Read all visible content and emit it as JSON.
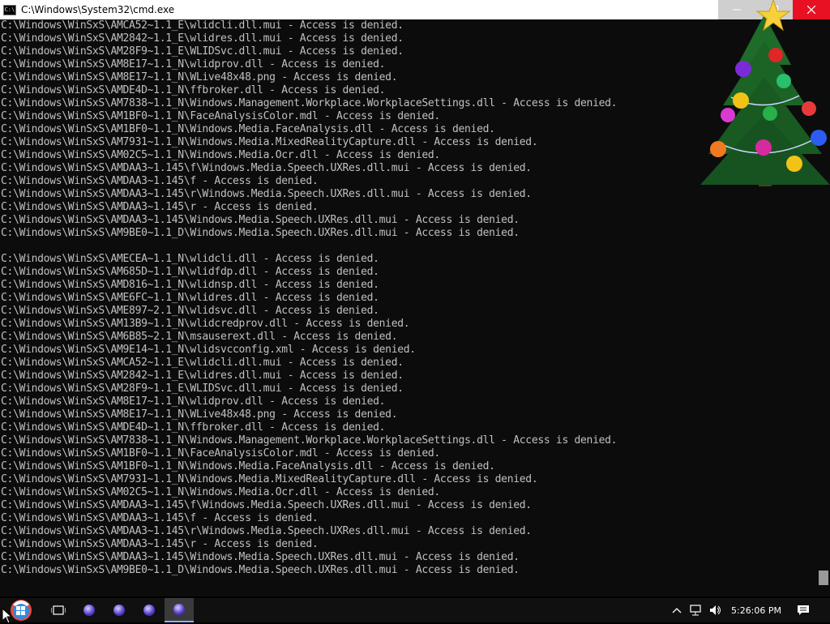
{
  "window": {
    "title": "C:\\Windows\\System32\\cmd.exe",
    "icon": "console-app-icon",
    "controls": [
      "minimize-icon",
      "maximize-icon",
      "close-icon"
    ]
  },
  "console": {
    "lines": [
      "C:\\Windows\\WinSxS\\AMCA52~1.1_E\\wlidcli.dll.mui - Access is denied.",
      "C:\\Windows\\WinSxS\\AM2842~1.1_E\\wlidres.dll.mui - Access is denied.",
      "C:\\Windows\\WinSxS\\AM28F9~1.1_E\\WLIDSvc.dll.mui - Access is denied.",
      "C:\\Windows\\WinSxS\\AM8E17~1.1_N\\wlidprov.dll - Access is denied.",
      "C:\\Windows\\WinSxS\\AM8E17~1.1_N\\WLive48x48.png - Access is denied.",
      "C:\\Windows\\WinSxS\\AMDE4D~1.1_N\\ffbroker.dll - Access is denied.",
      "C:\\Windows\\WinSxS\\AM7838~1.1_N\\Windows.Management.Workplace.WorkplaceSettings.dll - Access is denied.",
      "C:\\Windows\\WinSxS\\AM1BF0~1.1_N\\FaceAnalysisColor.mdl - Access is denied.",
      "C:\\Windows\\WinSxS\\AM1BF0~1.1_N\\Windows.Media.FaceAnalysis.dll - Access is denied.",
      "C:\\Windows\\WinSxS\\AM7931~1.1_N\\Windows.Media.MixedRealityCapture.dll - Access is denied.",
      "C:\\Windows\\WinSxS\\AM02C5~1.1_N\\Windows.Media.Ocr.dll - Access is denied.",
      "C:\\Windows\\WinSxS\\AMDAA3~1.145\\f\\Windows.Media.Speech.UXRes.dll.mui - Access is denied.",
      "C:\\Windows\\WinSxS\\AMDAA3~1.145\\f - Access is denied.",
      "C:\\Windows\\WinSxS\\AMDAA3~1.145\\r\\Windows.Media.Speech.UXRes.dll.mui - Access is denied.",
      "C:\\Windows\\WinSxS\\AMDAA3~1.145\\r - Access is denied.",
      "C:\\Windows\\WinSxS\\AMDAA3~1.145\\Windows.Media.Speech.UXRes.dll.mui - Access is denied.",
      "C:\\Windows\\WinSxS\\AM9BE0~1.1_D\\Windows.Media.Speech.UXRes.dll.mui - Access is denied.",
      "",
      "C:\\Windows\\WinSxS\\AMECEA~1.1_N\\wlidcli.dll - Access is denied.",
      "C:\\Windows\\WinSxS\\AM685D~1.1_N\\wlidfdp.dll - Access is denied.",
      "C:\\Windows\\WinSxS\\AMD816~1.1_N\\wlidnsp.dll - Access is denied.",
      "C:\\Windows\\WinSxS\\AME6FC~1.1_N\\wlidres.dll - Access is denied.",
      "C:\\Windows\\WinSxS\\AME897~2.1_N\\wlidsvc.dll - Access is denied.",
      "C:\\Windows\\WinSxS\\AM13B9~1.1_N\\wlidcredprov.dll - Access is denied.",
      "C:\\Windows\\WinSxS\\AM6B85~2.1_N\\msauserext.dll - Access is denied.",
      "C:\\Windows\\WinSxS\\AM9E14~1.1_N\\wlidsvcconfig.xml - Access is denied.",
      "C:\\Windows\\WinSxS\\AMCA52~1.1_E\\wlidcli.dll.mui - Access is denied.",
      "C:\\Windows\\WinSxS\\AM2842~1.1_E\\wlidres.dll.mui - Access is denied.",
      "C:\\Windows\\WinSxS\\AM28F9~1.1_E\\WLIDSvc.dll.mui - Access is denied.",
      "C:\\Windows\\WinSxS\\AM8E17~1.1_N\\wlidprov.dll - Access is denied.",
      "C:\\Windows\\WinSxS\\AM8E17~1.1_N\\WLive48x48.png - Access is denied.",
      "C:\\Windows\\WinSxS\\AMDE4D~1.1_N\\ffbroker.dll - Access is denied.",
      "C:\\Windows\\WinSxS\\AM7838~1.1_N\\Windows.Management.Workplace.WorkplaceSettings.dll - Access is denied.",
      "C:\\Windows\\WinSxS\\AM1BF0~1.1_N\\FaceAnalysisColor.mdl - Access is denied.",
      "C:\\Windows\\WinSxS\\AM1BF0~1.1_N\\Windows.Media.FaceAnalysis.dll - Access is denied.",
      "C:\\Windows\\WinSxS\\AM7931~1.1_N\\Windows.Media.MixedRealityCapture.dll - Access is denied.",
      "C:\\Windows\\WinSxS\\AM02C5~1.1_N\\Windows.Media.Ocr.dll - Access is denied.",
      "C:\\Windows\\WinSxS\\AMDAA3~1.145\\f\\Windows.Media.Speech.UXRes.dll.mui - Access is denied.",
      "C:\\Windows\\WinSxS\\AMDAA3~1.145\\f - Access is denied.",
      "C:\\Windows\\WinSxS\\AMDAA3~1.145\\r\\Windows.Media.Speech.UXRes.dll.mui - Access is denied.",
      "C:\\Windows\\WinSxS\\AMDAA3~1.145\\r - Access is denied.",
      "C:\\Windows\\WinSxS\\AMDAA3~1.145\\Windows.Media.Speech.UXRes.dll.mui - Access is denied.",
      "C:\\Windows\\WinSxS\\AM9BE0~1.1_D\\Windows.Media.Speech.UXRes.dll.mui - Access is denied."
    ],
    "text_color": "#c0c0c0",
    "background_color": "#0c0c0c"
  },
  "desktop_decoration": {
    "icon": "christmas-tree-icon"
  },
  "taskbar": {
    "start_icon": "windows-start-icon",
    "task_view_icon": "task-view-icon",
    "apps": [
      {
        "icon": "app-orb-icon",
        "active": false
      },
      {
        "icon": "app-orb-icon",
        "active": false
      },
      {
        "icon": "app-orb-icon",
        "active": false
      },
      {
        "icon": "app-orb-icon",
        "active": true
      }
    ],
    "tray_icons": [
      "chevron-up-icon",
      "network-icon",
      "volume-icon"
    ],
    "clock": "5:26:06 PM",
    "notification_icon": "action-center-icon"
  }
}
